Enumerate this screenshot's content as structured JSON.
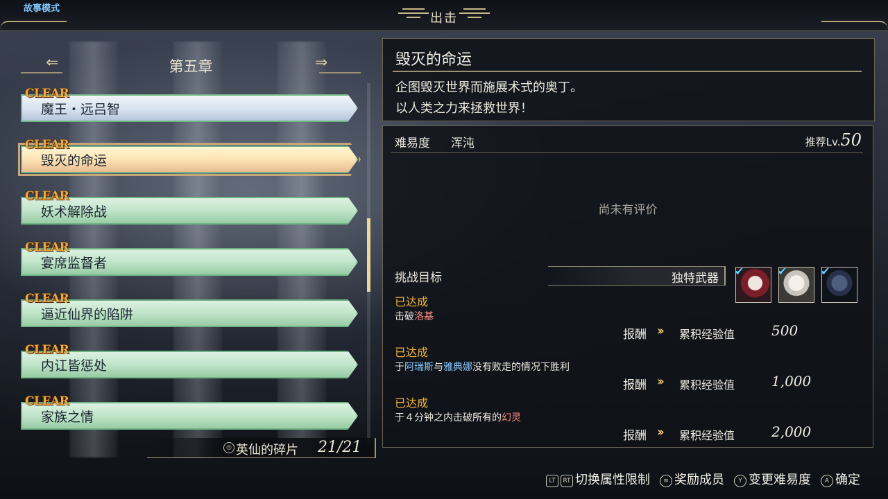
{
  "header": {
    "mode": "故事模式",
    "title": "出击"
  },
  "chapter": {
    "title": "第五章",
    "prev_icon": "arrow-left-icon",
    "next_icon": "arrow-right-icon"
  },
  "missions": [
    {
      "clear": "CLEAR",
      "name": "魔王・远吕智",
      "style": "blue"
    },
    {
      "clear": "CLEAR",
      "name": "毁灭的命运",
      "style": "selected"
    },
    {
      "clear": "CLEAR",
      "name": "妖术解除战",
      "style": "green"
    },
    {
      "clear": "CLEAR",
      "name": "宴席监督者",
      "style": "green"
    },
    {
      "clear": "CLEAR",
      "name": "逼近仙界的陷阱",
      "style": "green"
    },
    {
      "clear": "CLEAR",
      "name": "内讧皆惩处",
      "style": "green"
    },
    {
      "clear": "CLEAR",
      "name": "家族之情",
      "style": "green"
    }
  ],
  "scrollbar": {
    "position": 0.47
  },
  "fragments": {
    "label": "英仙的碎片",
    "count": "21/21"
  },
  "info": {
    "title": "毁灭的命运",
    "desc1": "企图毁灭世界而施展术式的奥丁。",
    "desc2": "以人类之力来拯救世界！"
  },
  "difficulty": {
    "label": "难易度",
    "value": "浑沌",
    "rec_label": "推荐Lv.",
    "rec_value": "50",
    "no_rating": "尚未有评价"
  },
  "challenge": {
    "label": "挑战目标",
    "weapon": "独特武器"
  },
  "portraits": [
    {
      "check": "✔",
      "name": "portrait-1"
    },
    {
      "check": "✔",
      "name": "portrait-2"
    },
    {
      "check": "✔",
      "name": "portrait-3"
    }
  ],
  "objectives": [
    {
      "status": "已达成",
      "parts": [
        {
          "t": "击破",
          "c": ""
        },
        {
          "t": "洛基",
          "c": "red"
        }
      ],
      "reward_label": "报酬",
      "reward_type": "累积经验值",
      "reward_value": "500"
    },
    {
      "status": "已达成",
      "parts": [
        {
          "t": "于",
          "c": ""
        },
        {
          "t": "阿瑞斯",
          "c": "blue"
        },
        {
          "t": "与",
          "c": ""
        },
        {
          "t": "雅典娜",
          "c": "blue"
        },
        {
          "t": "没有败走的情况下胜利",
          "c": ""
        }
      ],
      "reward_label": "报酬",
      "reward_type": "累积经验值",
      "reward_value": "1,000"
    },
    {
      "status": "已达成",
      "parts": [
        {
          "t": "于４分钟之内击破所有的",
          "c": ""
        },
        {
          "t": "幻灵",
          "c": "red"
        }
      ],
      "reward_label": "报酬",
      "reward_type": "累积经验值",
      "reward_value": "2,000"
    }
  ],
  "footer": [
    {
      "glyphs": [
        "LT",
        "RT"
      ],
      "label": "切换属性限制"
    },
    {
      "glyphs": [
        "≡"
      ],
      "label": "奖励成员"
    },
    {
      "glyphs": [
        "Y"
      ],
      "label": "变更难易度"
    },
    {
      "glyphs": [
        "A"
      ],
      "label": "确定"
    }
  ]
}
